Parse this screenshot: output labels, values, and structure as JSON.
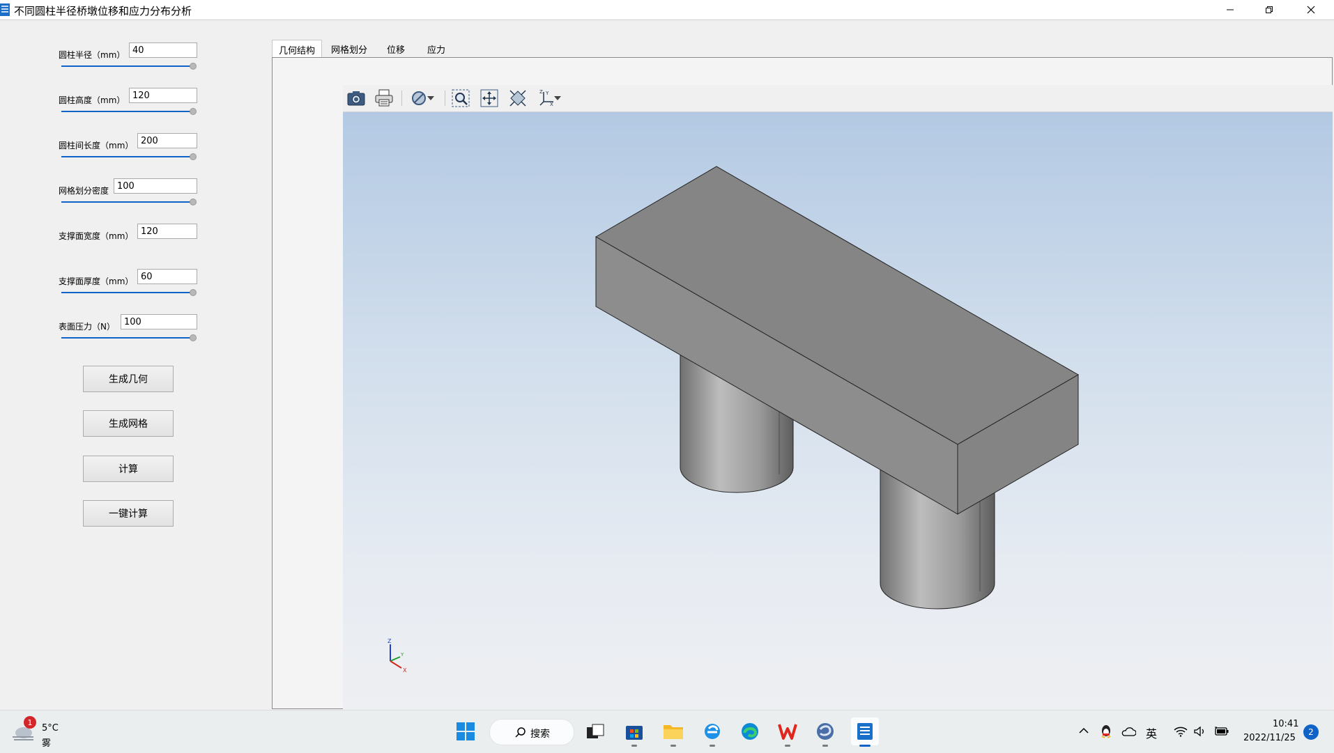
{
  "window": {
    "title": "不同圆柱半径桥墩位移和应力分布分析"
  },
  "params": [
    {
      "label": "圆柱半径（mm）",
      "value": "40",
      "slider": 1.0
    },
    {
      "label": "圆柱高度（mm）",
      "value": "120",
      "slider": 1.0
    },
    {
      "label": "圆柱间长度（mm）",
      "value": "200",
      "slider": 1.0
    },
    {
      "label": "网格划分密度",
      "value": "100",
      "slider": 1.0
    },
    {
      "label": "支撑面宽度（mm）",
      "value": "120",
      "slider": null
    },
    {
      "label": "支撑面厚度（mm）",
      "value": "60",
      "slider": 1.0
    },
    {
      "label": "表面压力（N）",
      "value": "100",
      "slider": 1.0
    }
  ],
  "buttons": {
    "generate_geometry": "生成几何",
    "generate_mesh": "生成网格",
    "compute": "计算",
    "one_click_compute": "一键计算"
  },
  "tabs": [
    {
      "label": "几何结构",
      "active": true
    },
    {
      "label": "网格划分",
      "active": false
    },
    {
      "label": "位移",
      "active": false
    },
    {
      "label": "应力",
      "active": false
    }
  ],
  "viewer_toolbar": [
    "camera-icon",
    "print-icon",
    "visibility-icon",
    "zoom-window-icon",
    "pan-icon",
    "zoom-extents-icon",
    "axes-icon"
  ],
  "axes_triad": {
    "x": "X",
    "y": "Y",
    "z": "Z"
  },
  "taskbar": {
    "weather": {
      "temp": "5°C",
      "desc": "雾",
      "badge": "1"
    },
    "search_label": "搜索",
    "tray_ime": "英",
    "clock_time": "10:41",
    "clock_date": "2022/11/25",
    "notifications": "2"
  },
  "colors": {
    "accent": "#0f62c7",
    "model_top": "#858585",
    "model_side": "#8d8d8d",
    "viewport_top": "#b3c9e3"
  }
}
